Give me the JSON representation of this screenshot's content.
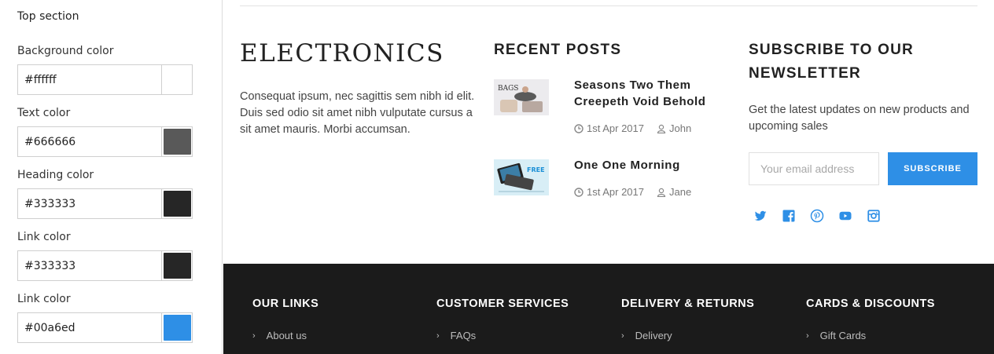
{
  "panel": {
    "title": "Top section",
    "fields": [
      {
        "label": "Background color",
        "value": "#ffffff",
        "swatch": "#ffffff"
      },
      {
        "label": "Text color",
        "value": "#666666",
        "swatch": "#595959"
      },
      {
        "label": "Heading color",
        "value": "#333333",
        "swatch": "#262626"
      },
      {
        "label": "Link color",
        "value": "#333333",
        "swatch": "#262626"
      },
      {
        "label": "Link color",
        "value": "#00a6ed",
        "swatch": "#2e8fe6"
      }
    ]
  },
  "brand": {
    "name": "ELECTRONICS",
    "about": "Consequat ipsum, nec sagittis sem nibh id elit. Duis sed odio sit amet nibh vulputate cursus a sit amet mauris. Morbi accumsan."
  },
  "recent_posts": {
    "heading": "RECENT POSTS",
    "posts": [
      {
        "title": "Seasons Two Them Creepeth Void Behold",
        "date": "1st Apr 2017",
        "author": "John",
        "thumb_text": "BAGS"
      },
      {
        "title": "One One Morning",
        "date": "1st Apr 2017",
        "author": "Jane",
        "thumb_text": ""
      }
    ]
  },
  "newsletter": {
    "heading_line1": "SUBSCRIBE TO OUR",
    "heading_line2": "NEWSLETTER",
    "text": "Get the latest updates on new products and upcoming sales",
    "placeholder": "Your email address",
    "button": "SUBSCRIBE",
    "social_icons": [
      "twitter-icon",
      "facebook-icon",
      "pinterest-icon",
      "youtube-icon",
      "instagram-icon"
    ],
    "accent": "#2e8fe6"
  },
  "footer": {
    "background": "#1b1b1b",
    "columns": [
      {
        "heading": "OUR LINKS",
        "link": "About us"
      },
      {
        "heading": "CUSTOMER SERVICES",
        "link": "FAQs"
      },
      {
        "heading": "DELIVERY & RETURNS",
        "link": "Delivery"
      },
      {
        "heading": "CARDS & DISCOUNTS",
        "link": "Gift Cards"
      }
    ]
  }
}
